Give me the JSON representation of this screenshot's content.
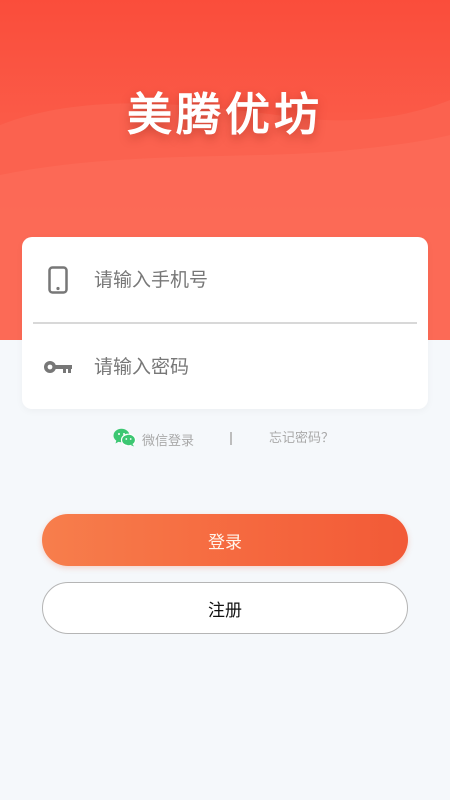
{
  "header": {
    "logo_text": "美腾优坊"
  },
  "login_form": {
    "phone_placeholder": "请输入手机号",
    "password_placeholder": "请输入密码",
    "phone_icon": "phone-icon",
    "password_icon": "key-icon"
  },
  "links": {
    "wechat_icon": "wechat-icon",
    "wechat_label": "微信登录",
    "separator": "I",
    "forgot_password": "忘记密码？"
  },
  "actions": {
    "login_label": "登录",
    "register_label": "注册"
  },
  "colors": {
    "header_red": "#fa4d3b",
    "login_button": "#f5673e",
    "wechat_green": "#3cc772"
  }
}
